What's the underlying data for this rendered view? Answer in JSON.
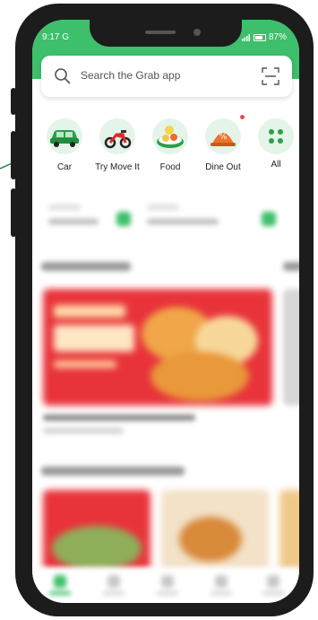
{
  "status": {
    "time": "9:17 G",
    "battery": "87%"
  },
  "search": {
    "placeholder": "Search the Grab app"
  },
  "shortcuts": [
    {
      "label": "Car",
      "icon": "car-icon"
    },
    {
      "label": "Try Move It",
      "icon": "motorbike-icon"
    },
    {
      "label": "Food",
      "icon": "food-icon"
    },
    {
      "label": "Dine Out",
      "icon": "dine-out-icon"
    },
    {
      "label": "All",
      "icon": "all-grid-icon"
    }
  ],
  "colors": {
    "brand": "#3dbf6b",
    "banner": "#e8333a",
    "badge": "#e84b4b"
  }
}
